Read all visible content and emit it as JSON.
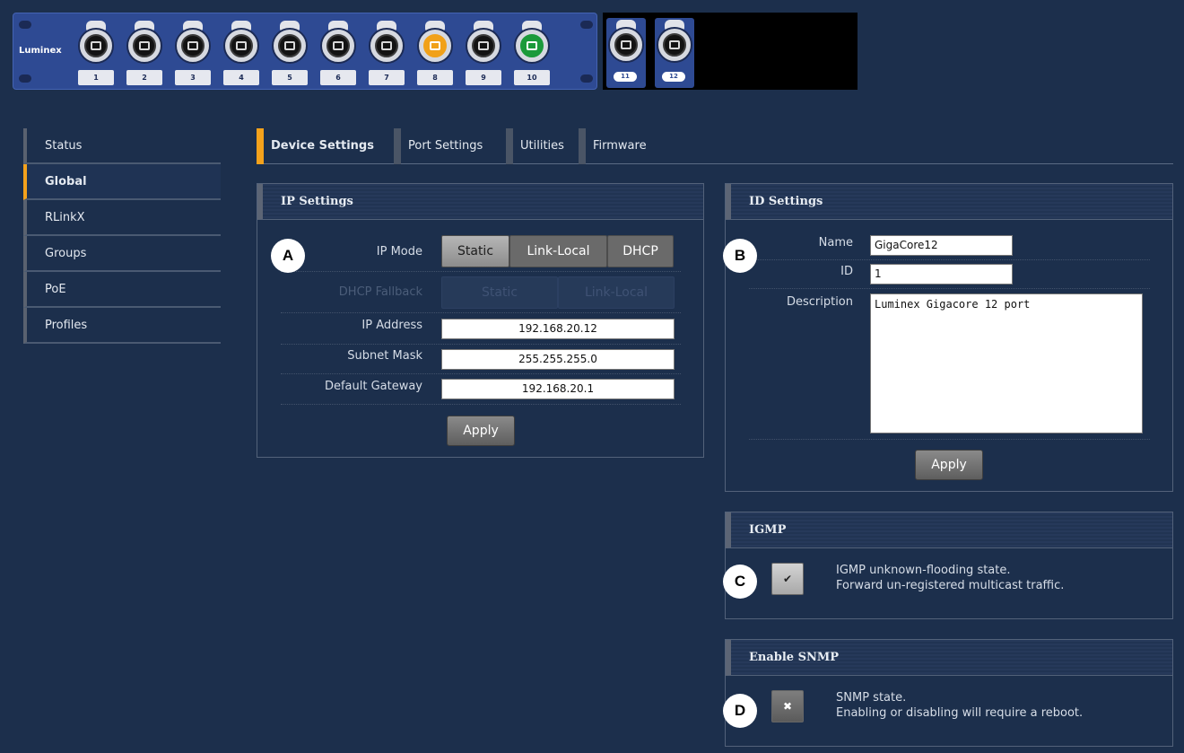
{
  "device": {
    "brand": "Luminex",
    "ports": [
      {
        "num": "1",
        "state": "black"
      },
      {
        "num": "2",
        "state": "black"
      },
      {
        "num": "3",
        "state": "black"
      },
      {
        "num": "4",
        "state": "black"
      },
      {
        "num": "5",
        "state": "black"
      },
      {
        "num": "6",
        "state": "black"
      },
      {
        "num": "7",
        "state": "black"
      },
      {
        "num": "8",
        "state": "orange"
      },
      {
        "num": "9",
        "state": "black"
      },
      {
        "num": "10",
        "state": "green"
      }
    ],
    "sfp_ports": [
      {
        "num": "11",
        "state": "black"
      },
      {
        "num": "12",
        "state": "black"
      }
    ],
    "colors": {
      "panel": "#2e4a93",
      "orange": "#f1a119",
      "green": "#1b9a3a"
    }
  },
  "sidebar": {
    "items": [
      {
        "label": "Status"
      },
      {
        "label": "Global",
        "active": true
      },
      {
        "label": "RLinkX"
      },
      {
        "label": "Groups"
      },
      {
        "label": "PoE"
      },
      {
        "label": "Profiles"
      }
    ]
  },
  "tabs": [
    {
      "label": "Device Settings",
      "active": true
    },
    {
      "label": "Port Settings"
    },
    {
      "label": "Utilities"
    },
    {
      "label": "Firmware"
    }
  ],
  "ip_settings": {
    "title": "IP Settings",
    "ip_mode_label": "IP Mode",
    "ip_mode_options": [
      "Static",
      "Link-Local",
      "DHCP"
    ],
    "ip_mode_selected": "Static",
    "dhcp_fallback_label": "DHCP Fallback",
    "dhcp_fallback_options": [
      "Static",
      "Link-Local"
    ],
    "ip_address_label": "IP Address",
    "ip_address": "192.168.20.12",
    "subnet_label": "Subnet Mask",
    "subnet": "255.255.255.0",
    "gateway_label": "Default Gateway",
    "gateway": "192.168.20.1",
    "apply": "Apply"
  },
  "id_settings": {
    "title": "ID Settings",
    "name_label": "Name",
    "name": "GigaCore12",
    "id_label": "ID",
    "id": "1",
    "description_label": "Description",
    "description": "Luminex Gigacore 12 port",
    "apply": "Apply"
  },
  "igmp": {
    "title": "IGMP",
    "checked": true,
    "line1": "IGMP unknown-flooding state.",
    "line2": "Forward un-registered multicast traffic."
  },
  "snmp": {
    "title": "Enable SNMP",
    "checked": false,
    "line1": "SNMP state.",
    "line2": "Enabling or disabling will require a reboot."
  },
  "markers": [
    "A",
    "B",
    "C",
    "D"
  ],
  "accent": "#f4a21c"
}
